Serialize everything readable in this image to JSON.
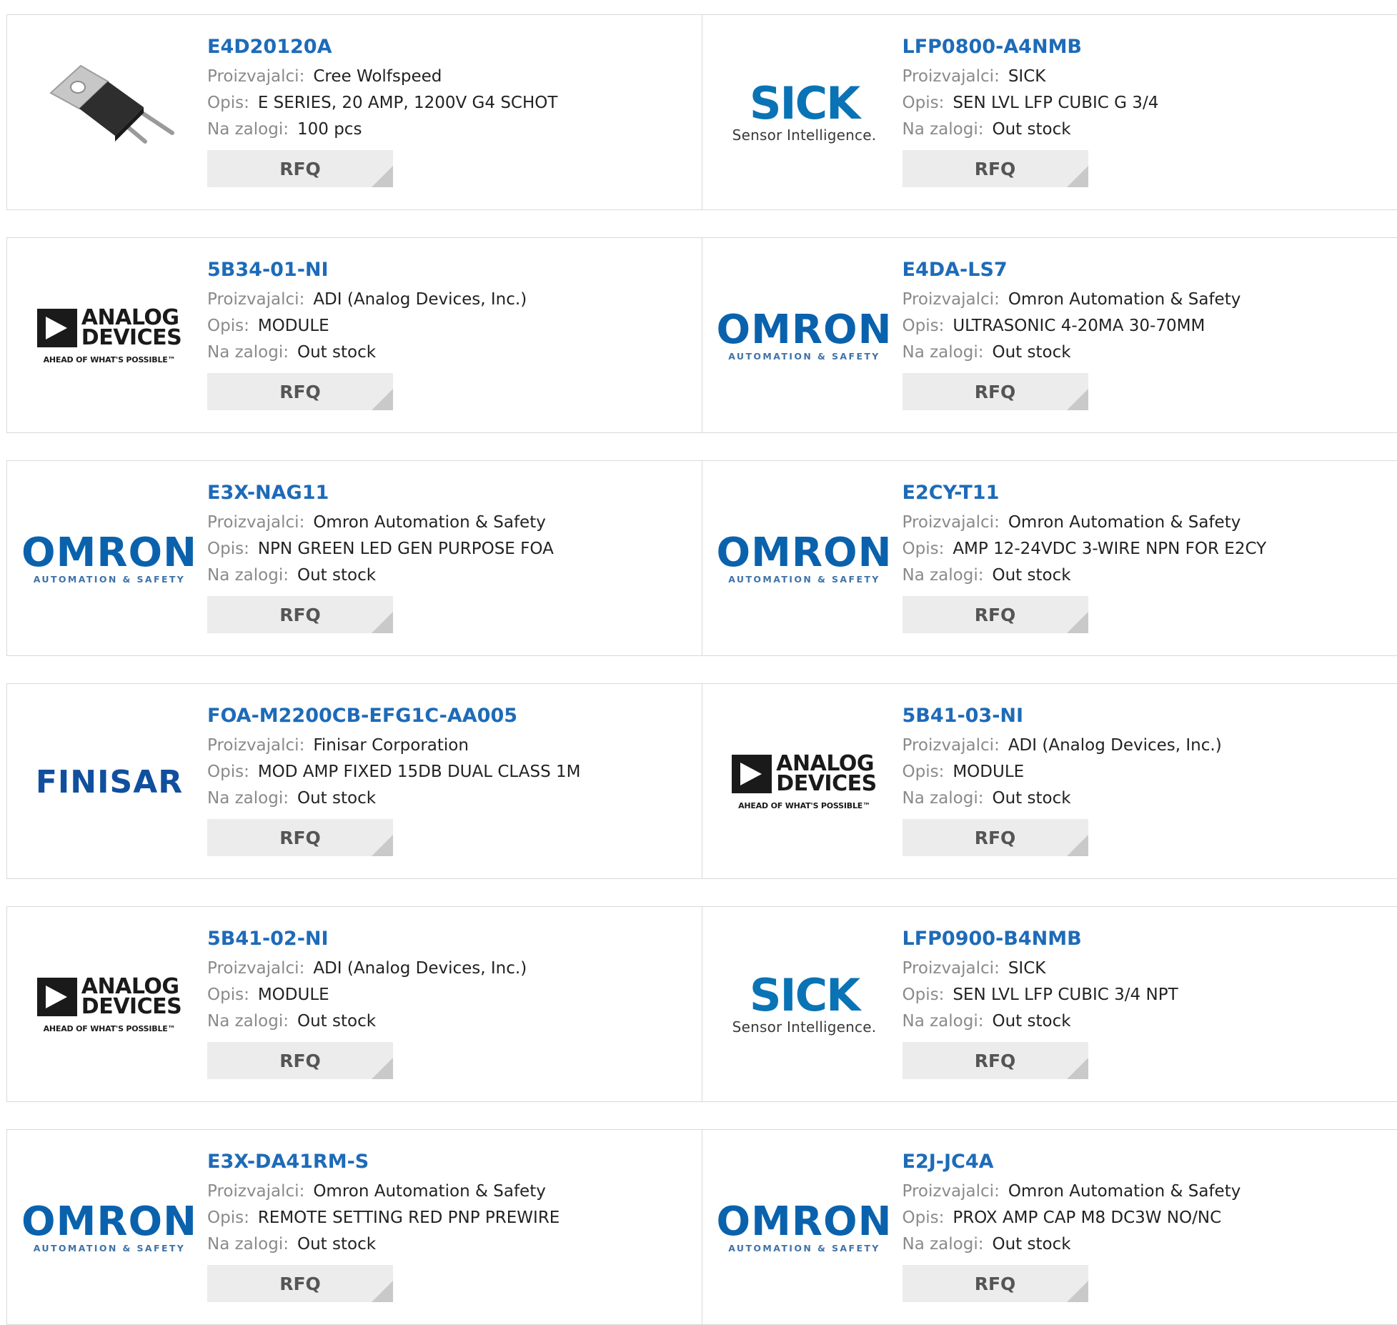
{
  "labels": {
    "manufacturer": "Proizvajalci:",
    "description": "Opis:",
    "stock": "Na zalogi:",
    "rfq": "RFQ"
  },
  "logos": {
    "sick": {
      "word": "SICK",
      "sub": "Sensor Intelligence."
    },
    "omron": {
      "word": "OMRON",
      "sub": "AUTOMATION & SAFETY"
    },
    "adi": {
      "word1": "ANALOG",
      "word2": "DEVICES",
      "sub": "AHEAD OF WHAT'S POSSIBLE™"
    },
    "finisar": {
      "word": "FINISAR"
    }
  },
  "colors": {
    "part_link": "#1e6bb8",
    "sick": "#0a73b5",
    "omron": "#0a62ad",
    "finisar": "#104f9e"
  },
  "products": [
    {
      "part": "E4D20120A",
      "manufacturer": "Cree Wolfspeed",
      "description": "E SERIES, 20 AMP, 1200V G4 SCHOT",
      "stock": "100 pcs",
      "logo": "to220-package-image"
    },
    {
      "part": "LFP0800-A4NMB",
      "manufacturer": "SICK",
      "description": "SEN LVL LFP CUBIC G 3/4",
      "stock": "Out stock",
      "logo": "sick"
    },
    {
      "part": "5B34-01-NI",
      "manufacturer": "ADI (Analog Devices, Inc.)",
      "description": "MODULE",
      "stock": "Out stock",
      "logo": "adi"
    },
    {
      "part": "E4DA-LS7",
      "manufacturer": "Omron Automation & Safety",
      "description": "ULTRASONIC 4-20MA 30-70MM",
      "stock": "Out stock",
      "logo": "omron"
    },
    {
      "part": "E3X-NAG11",
      "manufacturer": "Omron Automation & Safety",
      "description": "NPN GREEN LED GEN PURPOSE FOA",
      "stock": "Out stock",
      "logo": "omron"
    },
    {
      "part": "E2CY-T11",
      "manufacturer": "Omron Automation & Safety",
      "description": "AMP 12-24VDC 3-WIRE NPN FOR E2CY",
      "stock": "Out stock",
      "logo": "omron"
    },
    {
      "part": "FOA-M2200CB-EFG1C-AA005",
      "manufacturer": "Finisar Corporation",
      "description": "MOD AMP FIXED 15DB DUAL CLASS 1M",
      "stock": "Out stock",
      "logo": "finisar"
    },
    {
      "part": "5B41-03-NI",
      "manufacturer": "ADI (Analog Devices, Inc.)",
      "description": "MODULE",
      "stock": "Out stock",
      "logo": "adi"
    },
    {
      "part": "5B41-02-NI",
      "manufacturer": "ADI (Analog Devices, Inc.)",
      "description": "MODULE",
      "stock": "Out stock",
      "logo": "adi"
    },
    {
      "part": "LFP0900-B4NMB",
      "manufacturer": "SICK",
      "description": "SEN LVL LFP CUBIC 3/4 NPT",
      "stock": "Out stock",
      "logo": "sick"
    },
    {
      "part": "E3X-DA41RM-S",
      "manufacturer": "Omron Automation & Safety",
      "description": "REMOTE SETTING RED PNP PREWIRE",
      "stock": "Out stock",
      "logo": "omron"
    },
    {
      "part": "E2J-JC4A",
      "manufacturer": "Omron Automation & Safety",
      "description": "PROX AMP CAP M8 DC3W NO/NC",
      "stock": "Out stock",
      "logo": "omron"
    }
  ]
}
